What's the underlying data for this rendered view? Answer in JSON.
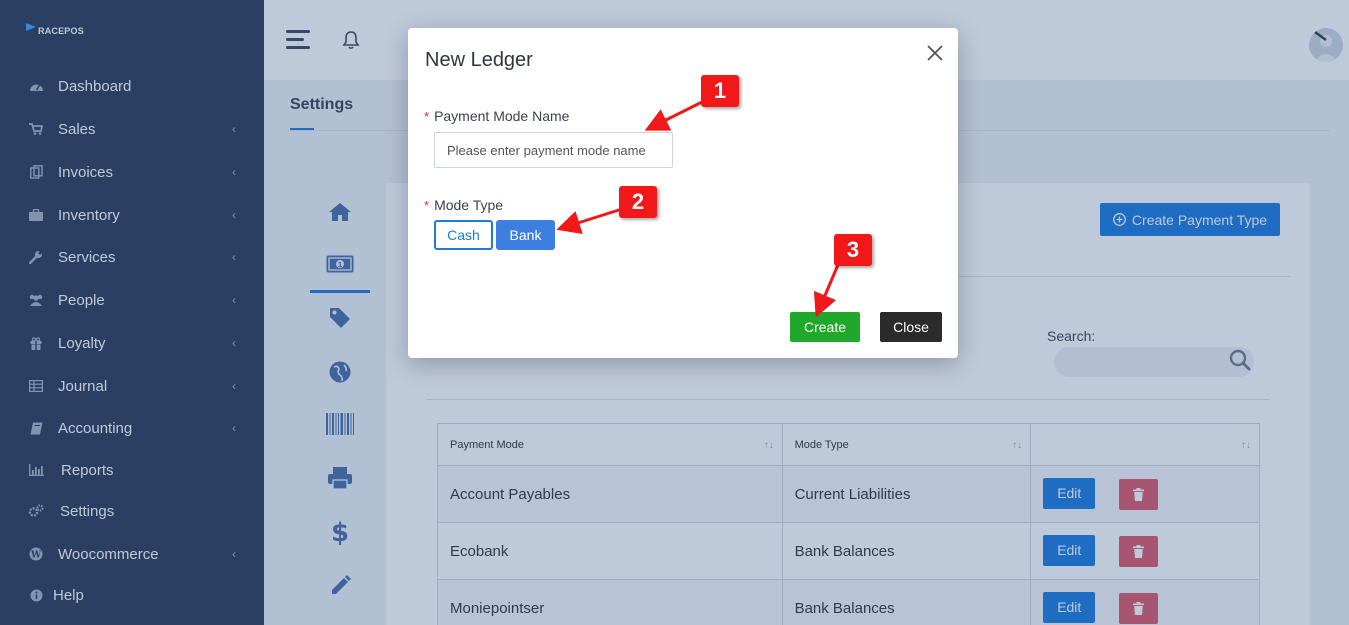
{
  "app": {
    "logo_text": "RACEPOS"
  },
  "sidebar": {
    "items": [
      {
        "label": "Dashboard",
        "icon": "dashboard-icon",
        "has_submenu": false
      },
      {
        "label": "Sales",
        "icon": "cart-icon",
        "has_submenu": true
      },
      {
        "label": "Invoices",
        "icon": "invoice-icon",
        "has_submenu": true
      },
      {
        "label": "Inventory",
        "icon": "briefcase-icon",
        "has_submenu": true
      },
      {
        "label": "Services",
        "icon": "wrench-icon",
        "has_submenu": true
      },
      {
        "label": "People",
        "icon": "people-icon",
        "has_submenu": true
      },
      {
        "label": "Loyalty",
        "icon": "gift-icon",
        "has_submenu": true
      },
      {
        "label": "Journal",
        "icon": "table-icon",
        "has_submenu": true
      },
      {
        "label": "Accounting",
        "icon": "book-icon",
        "has_submenu": true
      },
      {
        "label": "Reports",
        "icon": "bar-chart-icon",
        "has_submenu": false
      },
      {
        "label": "Settings",
        "icon": "gears-icon",
        "has_submenu": false
      },
      {
        "label": "Woocommerce",
        "icon": "wordpress-icon",
        "has_submenu": true
      },
      {
        "label": "Help",
        "icon": "info-icon",
        "has_submenu": false
      }
    ]
  },
  "page": {
    "title": "Settings",
    "create_payment_type_label": "Create Payment Type",
    "search_label": "Search:"
  },
  "table": {
    "headers": [
      "Payment Mode",
      "Mode Type",
      ""
    ],
    "rows": [
      {
        "mode": "Account Payables",
        "type": "Current Liabilities"
      },
      {
        "mode": "Ecobank",
        "type": "Bank Balances"
      },
      {
        "mode": "Moniepointser",
        "type": "Bank Balances"
      }
    ],
    "edit_label": "Edit"
  },
  "modal": {
    "title": "New Ledger",
    "payment_mode_label": "Payment Mode Name",
    "payment_mode_placeholder": "Please enter payment mode name",
    "mode_type_label": "Mode Type",
    "cash_label": "Cash",
    "bank_label": "Bank",
    "create_label": "Create",
    "close_label": "Close",
    "required_mark": "*"
  },
  "callouts": [
    "1",
    "2",
    "3"
  ],
  "colors": {
    "sidebar_bg": "#2b3a55",
    "primary": "#1c7ae0",
    "success": "#1fa82a",
    "danger": "#e05a6c",
    "callout": "#f01818"
  }
}
